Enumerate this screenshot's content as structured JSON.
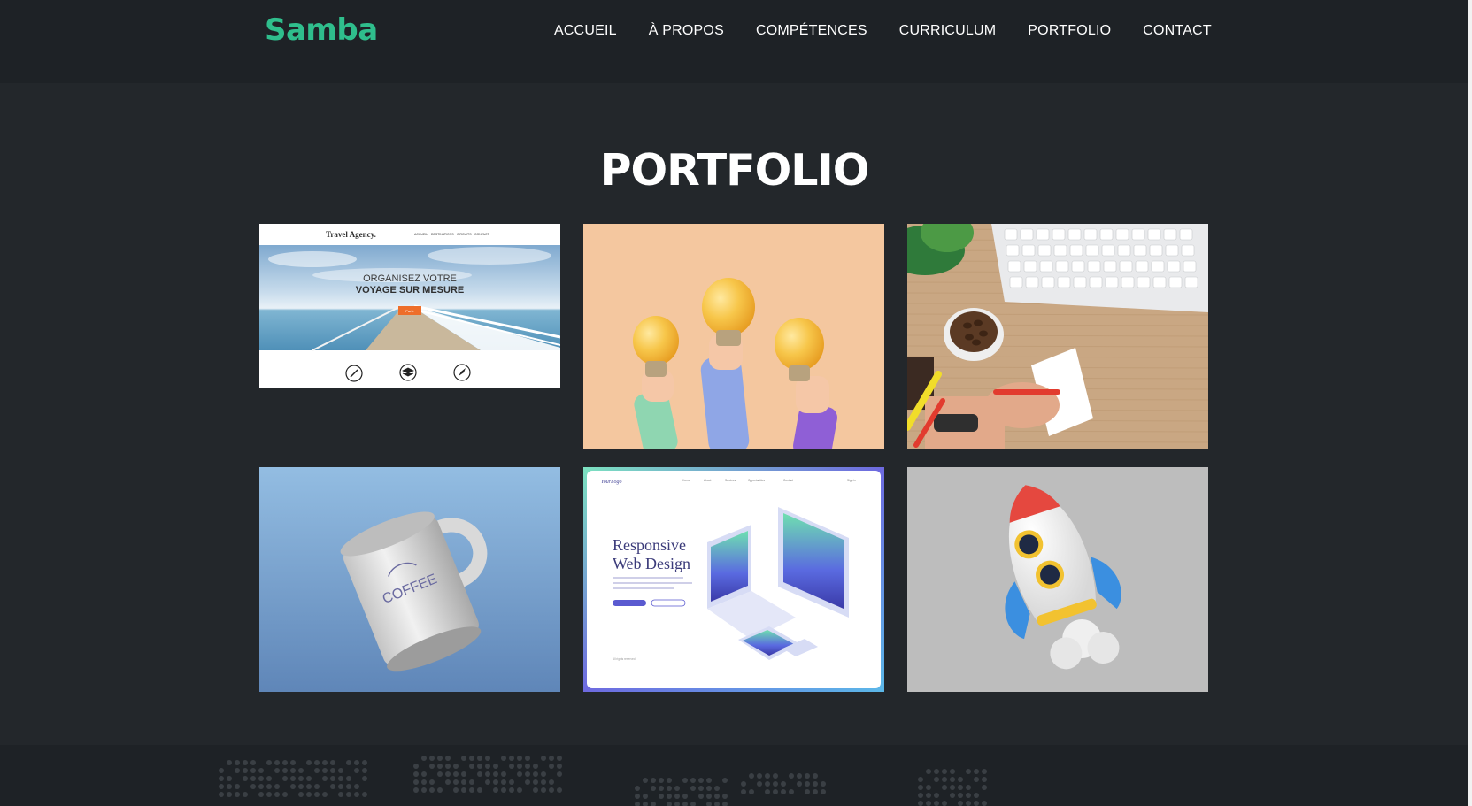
{
  "brand": {
    "name": "Samba",
    "color": "#2fbe8c"
  },
  "nav": {
    "items": [
      {
        "label": "ACCUEIL"
      },
      {
        "label": "À PROPOS"
      },
      {
        "label": "COMPÉTENCES"
      },
      {
        "label": "CURRICULUM"
      },
      {
        "label": "PORTFOLIO"
      },
      {
        "label": "CONTACT"
      }
    ]
  },
  "portfolio": {
    "title": "PORTFOLIO",
    "items": [
      {
        "name": "travel-agency",
        "site_title": "Travel Agency.",
        "site_nav": [
          "ACCUEIL",
          "DESTINATIONS",
          "CIRCUITS",
          "CONTACT"
        ],
        "headline_line1": "ORGANISEZ VOTRE",
        "headline_line2": "VOYAGE SUR MESURE",
        "button": "Partir",
        "icons": [
          "pencil-icon",
          "layers-icon",
          "rocket-icon"
        ]
      },
      {
        "name": "lightbulbs",
        "icon": "lightbulb-icon"
      },
      {
        "name": "desk-keyboard-coffee",
        "icon": "keyboard-icon"
      },
      {
        "name": "coffee-mug",
        "mug_text": "COFFEE",
        "icon": "mug-icon"
      },
      {
        "name": "responsive-web-design",
        "logo": "YourLogo",
        "nav": [
          "Home",
          "About",
          "Services",
          "Opportunities",
          "Contact"
        ],
        "signin": "Sign in",
        "headline_line1": "Responsive",
        "headline_line2": "Web Design",
        "footer_note": "All rights reserved"
      },
      {
        "name": "rocket",
        "icon": "rocket-icon"
      }
    ]
  }
}
